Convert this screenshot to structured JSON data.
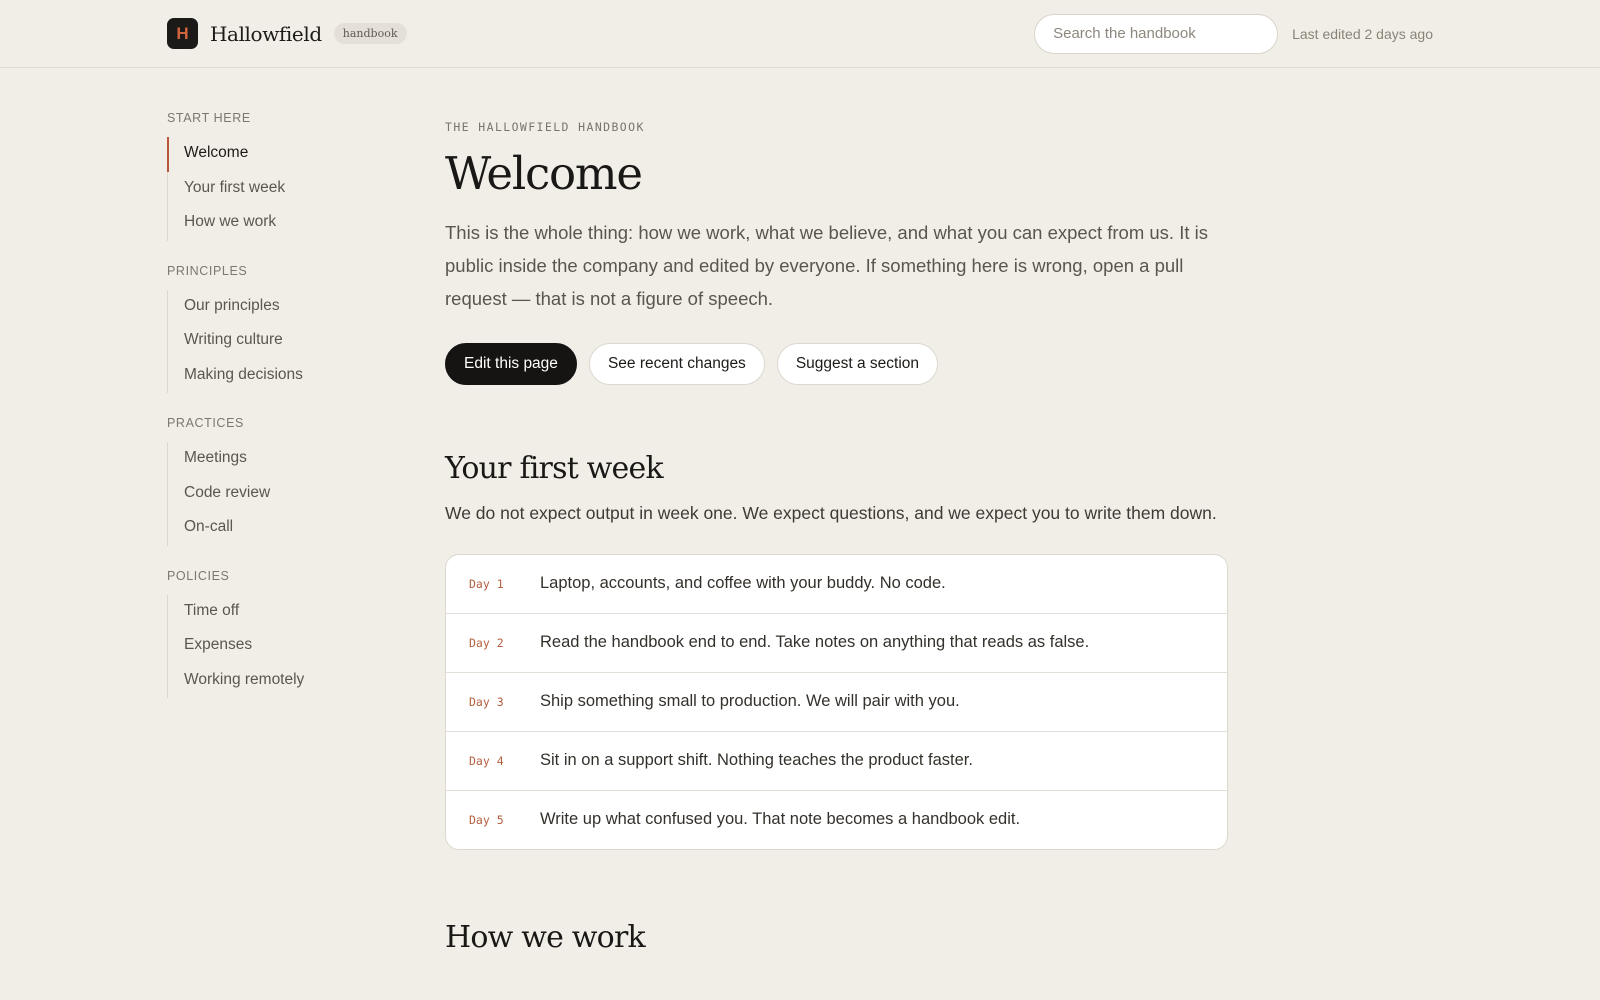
{
  "header": {
    "logo_letter": "H",
    "brand_name": "Hallowfield",
    "brand_tag": "handbook",
    "search_placeholder": "Search the handbook",
    "last_edited": "Last edited 2 days ago"
  },
  "sidebar": {
    "groups": [
      {
        "heading": "START HERE",
        "items": [
          "Welcome",
          "Your first week",
          "How we work"
        ]
      },
      {
        "heading": "PRINCIPLES",
        "items": [
          "Our principles",
          "Writing culture",
          "Making decisions"
        ]
      },
      {
        "heading": "PRACTICES",
        "items": [
          "Meetings",
          "Code review",
          "On-call"
        ]
      },
      {
        "heading": "POLICIES",
        "items": [
          "Time off",
          "Expenses",
          "Working remotely"
        ]
      }
    ],
    "active_item": "Welcome"
  },
  "main": {
    "eyebrow": "THE HALLOWFIELD HANDBOOK",
    "title": "Welcome",
    "lede": "This is the whole thing: how we work, what we believe, and what you can expect from us. It is public inside the company and edited by everyone. If something here is wrong, open a pull request — that is not a figure of speech.",
    "actions": {
      "edit": "Edit this page",
      "changes": "See recent changes",
      "suggest": "Suggest a section"
    },
    "first_week": {
      "title": "Your first week",
      "intro": "We do not expect output in week one. We expect questions, and we expect you to write them down.",
      "days": [
        {
          "label": "Day 1",
          "text": "Laptop, accounts, and coffee with your buddy. No code."
        },
        {
          "label": "Day 2",
          "text": "Read the handbook end to end. Take notes on anything that reads as false."
        },
        {
          "label": "Day 3",
          "text": "Ship something small to production. We will pair with you."
        },
        {
          "label": "Day 4",
          "text": "Sit in on a support shift. Nothing teaches the product faster."
        },
        {
          "label": "Day 5",
          "text": "Write up what confused you. That note becomes a handbook edit."
        }
      ]
    },
    "how_we_work": {
      "title": "How we work"
    }
  },
  "colors": {
    "background": "#f1eee8",
    "accent": "#b8563a",
    "primary_button": "#161412"
  }
}
